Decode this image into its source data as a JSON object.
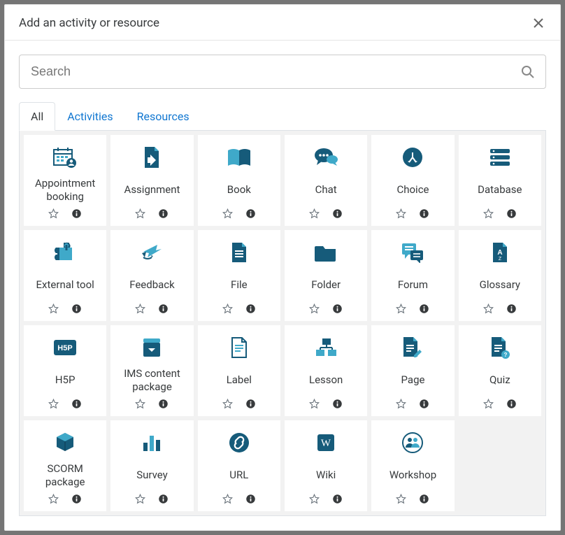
{
  "header": {
    "title": "Add an activity or resource"
  },
  "search": {
    "placeholder": "Search",
    "value": ""
  },
  "tabs": {
    "all": "All",
    "activities": "Activities",
    "resources": "Resources",
    "active": "all"
  },
  "colors": {
    "primary": "#1177d1",
    "iconDark": "#0f4c75",
    "iconLight": "#3fa9c9"
  },
  "items": [
    {
      "id": "appointment",
      "label": "Appointment booking"
    },
    {
      "id": "assignment",
      "label": "Assignment"
    },
    {
      "id": "book",
      "label": "Book"
    },
    {
      "id": "chat",
      "label": "Chat"
    },
    {
      "id": "choice",
      "label": "Choice"
    },
    {
      "id": "database",
      "label": "Database"
    },
    {
      "id": "externaltool",
      "label": "External tool"
    },
    {
      "id": "feedback",
      "label": "Feedback"
    },
    {
      "id": "file",
      "label": "File"
    },
    {
      "id": "folder",
      "label": "Folder"
    },
    {
      "id": "forum",
      "label": "Forum"
    },
    {
      "id": "glossary",
      "label": "Glossary"
    },
    {
      "id": "h5p",
      "label": "H5P"
    },
    {
      "id": "ims",
      "label": "IMS content package"
    },
    {
      "id": "label",
      "label": "Label"
    },
    {
      "id": "lesson",
      "label": "Lesson"
    },
    {
      "id": "page",
      "label": "Page"
    },
    {
      "id": "quiz",
      "label": "Quiz"
    },
    {
      "id": "scorm",
      "label": "SCORM package"
    },
    {
      "id": "survey",
      "label": "Survey"
    },
    {
      "id": "url",
      "label": "URL"
    },
    {
      "id": "wiki",
      "label": "Wiki"
    },
    {
      "id": "workshop",
      "label": "Workshop"
    }
  ]
}
